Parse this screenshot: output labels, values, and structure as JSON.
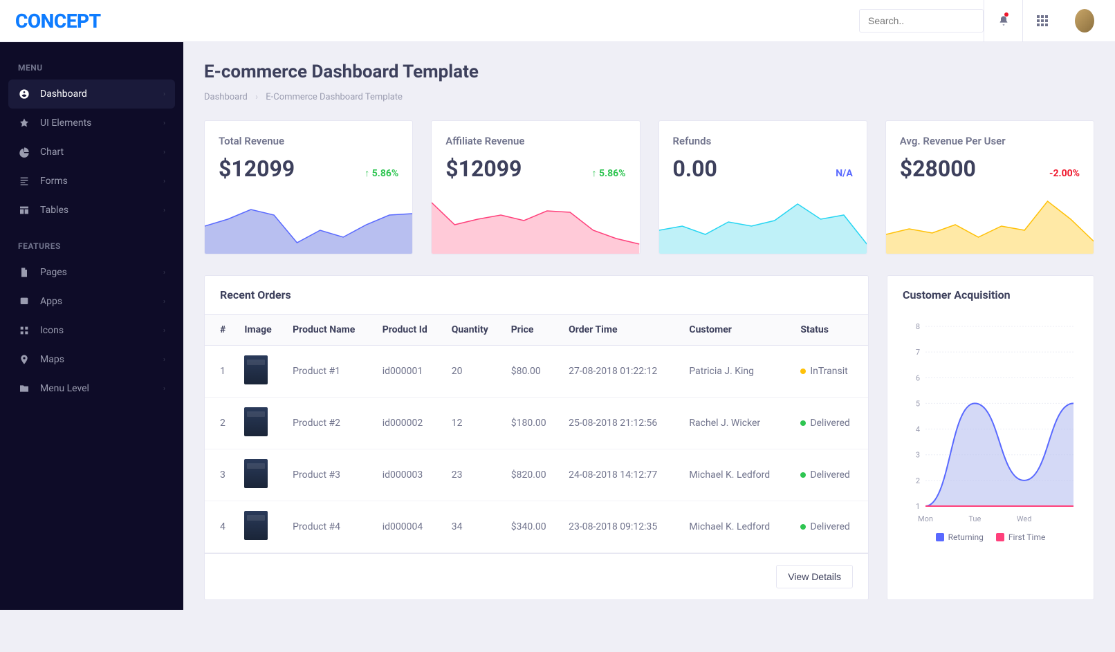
{
  "brand": "CONCEPT",
  "search": {
    "placeholder": "Search.."
  },
  "sidebar": {
    "section1": "MENU",
    "section2": "FEATURES",
    "menu_items": [
      {
        "label": "Dashboard",
        "icon": "dashboard",
        "active": true
      },
      {
        "label": "UI Elements",
        "icon": "rocket"
      },
      {
        "label": "Chart",
        "icon": "piechart"
      },
      {
        "label": "Forms",
        "icon": "form"
      },
      {
        "label": "Tables",
        "icon": "table"
      }
    ],
    "feature_items": [
      {
        "label": "Pages",
        "icon": "file"
      },
      {
        "label": "Apps",
        "icon": "app"
      },
      {
        "label": "Icons",
        "icon": "icons"
      },
      {
        "label": "Maps",
        "icon": "map"
      },
      {
        "label": "Menu Level",
        "icon": "folder"
      }
    ]
  },
  "page": {
    "title": "E-commerce Dashboard Template",
    "crumb1": "Dashboard",
    "crumb2": "E-Commerce Dashboard Template"
  },
  "stats": [
    {
      "label": "Total Revenue",
      "value": "$12099",
      "change": "5.86%",
      "dir": "up",
      "color": "#5969ff",
      "fill": "#b8bff0"
    },
    {
      "label": "Affiliate Revenue",
      "value": "$12099",
      "change": "5.86%",
      "dir": "up",
      "color": "#ff407b",
      "fill": "#ffcad8"
    },
    {
      "label": "Refunds",
      "value": "0.00",
      "change": "N/A",
      "dir": "na",
      "color": "#25d5f2",
      "fill": "#bff1f8"
    },
    {
      "label": "Avg. Revenue Per User",
      "value": "$28000",
      "change": "-2.00%",
      "dir": "down",
      "color": "#ffc108",
      "fill": "#ffe9a6"
    }
  ],
  "orders": {
    "title": "Recent Orders",
    "headers": [
      "#",
      "Image",
      "Product Name",
      "Product Id",
      "Quantity",
      "Price",
      "Order Time",
      "Customer",
      "Status"
    ],
    "rows": [
      {
        "n": "1",
        "name": "Product #1",
        "pid": "id000001",
        "qty": "20",
        "price": "$80.00",
        "time": "27-08-2018 01:22:12",
        "cust": "Patricia J. King",
        "status": "InTransit"
      },
      {
        "n": "2",
        "name": "Product #2",
        "pid": "id000002",
        "qty": "12",
        "price": "$180.00",
        "time": "25-08-2018 21:12:56",
        "cust": "Rachel J. Wicker",
        "status": "Delivered"
      },
      {
        "n": "3",
        "name": "Product #3",
        "pid": "id000003",
        "qty": "23",
        "price": "$820.00",
        "time": "24-08-2018 14:12:77",
        "cust": "Michael K. Ledford",
        "status": "Delivered"
      },
      {
        "n": "4",
        "name": "Product #4",
        "pid": "id000004",
        "qty": "34",
        "price": "$340.00",
        "time": "23-08-2018 09:12:35",
        "cust": "Michael K. Ledford",
        "status": "Delivered"
      }
    ],
    "view_details": "View Details"
  },
  "acquisition": {
    "title": "Customer Acquisition",
    "legend_returning": "Returning",
    "legend_first": "First Time"
  },
  "chart_data": {
    "type": "line",
    "title": "Customer Acquisition",
    "x": [
      "Mon",
      "Tue",
      "Wed"
    ],
    "ylim": [
      1,
      8
    ],
    "yticks": [
      1,
      2,
      3,
      4,
      5,
      6,
      7,
      8
    ],
    "series": [
      {
        "name": "Returning",
        "color": "#5969ff",
        "values": [
          1,
          5,
          2,
          5
        ]
      },
      {
        "name": "First Time",
        "color": "#ff407b",
        "values": [
          1,
          1,
          1,
          1
        ]
      }
    ]
  },
  "sparklines": [
    [
      50,
      40,
      26,
      34,
      74,
      56,
      66,
      48,
      34,
      32
    ],
    [
      16,
      48,
      40,
      34,
      42,
      28,
      30,
      56,
      68,
      76
    ],
    [
      56,
      50,
      62,
      44,
      50,
      42,
      18,
      40,
      34,
      76
    ],
    [
      62,
      54,
      60,
      48,
      66,
      50,
      56,
      14,
      40,
      72
    ]
  ]
}
